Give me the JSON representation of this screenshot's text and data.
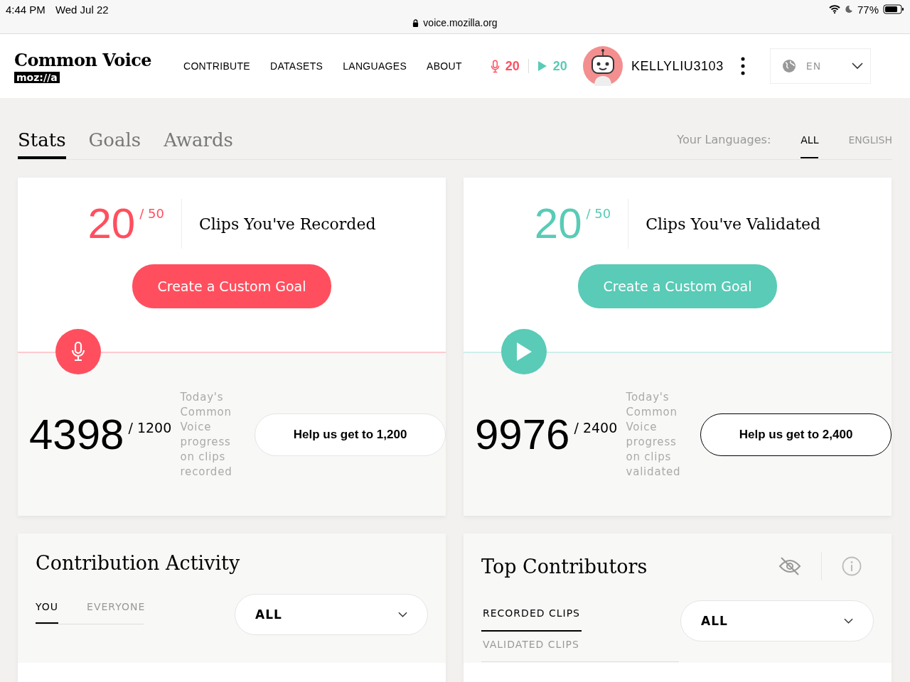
{
  "status_bar": {
    "time": "4:44 PM",
    "date": "Wed Jul 22",
    "battery": "77%"
  },
  "browser": {
    "url": "voice.mozilla.org"
  },
  "header": {
    "logo_title": "Common Voice",
    "logo_sub": "moz://a",
    "nav": [
      {
        "label": "CONTRIBUTE"
      },
      {
        "label": "DATASETS"
      },
      {
        "label": "LANGUAGES"
      },
      {
        "label": "ABOUT"
      }
    ],
    "recorded_count": "20",
    "validated_count": "20",
    "username": "KELLYLIU3103",
    "language": "EN"
  },
  "tabs": [
    {
      "label": "Stats",
      "selected": true
    },
    {
      "label": "Goals",
      "selected": false
    },
    {
      "label": "Awards",
      "selected": false
    }
  ],
  "languages": {
    "label": "Your Languages:",
    "options": [
      {
        "label": "ALL",
        "selected": true
      },
      {
        "label": "ENGLISH",
        "selected": false
      }
    ]
  },
  "goal_cards": [
    {
      "kind": "record",
      "color": "#ff4f5e",
      "count": "20",
      "total": "/ 50",
      "title": "Clips You've Recorded",
      "button": "Create a Custom Goal",
      "today": "4398",
      "today_total": "/ 1200",
      "caption": "Today's Common Voice progress on clips recorded",
      "help_button": "Help us get to 1,200"
    },
    {
      "kind": "validate",
      "color": "#59cbb7",
      "count": "20",
      "total": "/ 50",
      "title": "Clips You've Validated",
      "button": "Create a Custom Goal",
      "today": "9976",
      "today_total": "/ 2400",
      "caption": "Today's Common Voice progress on clips validated",
      "help_button": "Help us get to 2,400"
    }
  ],
  "activity": {
    "title": "Contribution Activity",
    "tabs": [
      {
        "label": "YOU",
        "selected": true
      },
      {
        "label": "EVERYONE",
        "selected": false
      }
    ],
    "dropdown": "ALL"
  },
  "contributors": {
    "title": "Top Contributors",
    "tabs": [
      {
        "label": "RECORDED CLIPS",
        "selected": true
      },
      {
        "label": "VALIDATED CLIPS",
        "selected": false
      }
    ],
    "dropdown": "ALL"
  }
}
